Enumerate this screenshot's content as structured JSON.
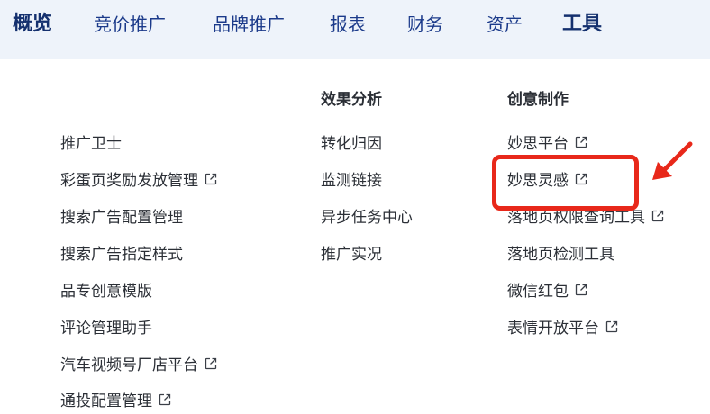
{
  "nav": {
    "items": [
      "概览",
      "竞价推广",
      "品牌推广",
      "报表",
      "财务",
      "资产",
      "工具"
    ]
  },
  "columns": {
    "left": {
      "header": "",
      "items": [
        {
          "label": "推广卫士",
          "external": false
        },
        {
          "label": "彩蛋页奖励发放管理",
          "external": true
        },
        {
          "label": "搜索广告配置管理",
          "external": false
        },
        {
          "label": "搜索广告指定样式",
          "external": false
        },
        {
          "label": "品专创意模版",
          "external": false
        },
        {
          "label": "评论管理助手",
          "external": false
        },
        {
          "label": "汽车视频号厂店平台",
          "external": true
        },
        {
          "label": "通投配置管理",
          "external": true
        }
      ]
    },
    "middle": {
      "header": "效果分析",
      "items": [
        {
          "label": "转化归因",
          "external": false
        },
        {
          "label": "监测链接",
          "external": false
        },
        {
          "label": "异步任务中心",
          "external": false
        },
        {
          "label": "推广实况",
          "external": false
        }
      ]
    },
    "right": {
      "header": "创意制作",
      "items": [
        {
          "label": "妙思平台",
          "external": true
        },
        {
          "label": "妙思灵感",
          "external": true
        },
        {
          "label": "落地页权限查询工具",
          "external": true
        },
        {
          "label": "落地页检测工具",
          "external": false
        },
        {
          "label": "微信红包",
          "external": true
        },
        {
          "label": "表情开放平台",
          "external": true
        }
      ]
    }
  },
  "colors": {
    "nav_bg": "#eef3fa",
    "nav_text": "#1b3a8a",
    "highlight": "#e8281a"
  },
  "icons": {
    "external": "external-link-icon",
    "annotation": "red-arrow-icon"
  }
}
